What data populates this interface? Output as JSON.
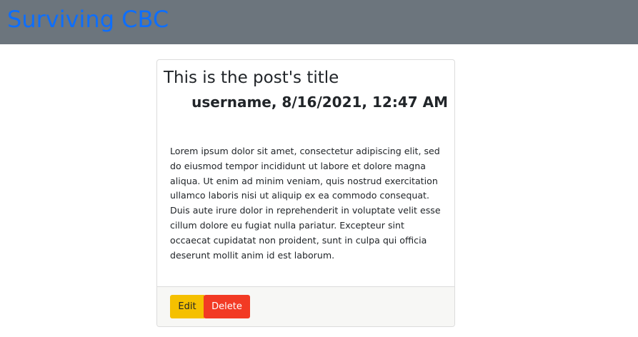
{
  "navbar": {
    "brand": "Surviving CBC"
  },
  "post": {
    "title": "This is the post's title",
    "byline": "username, 8/16/2021, 12:47 AM",
    "body": "Lorem ipsum dolor sit amet, consectetur adipiscing elit, sed do eiusmod tempor incididunt ut labore et dolore magna aliqua. Ut enim ad minim veniam, quis nostrud exercitation ullamco laboris nisi ut aliquip ex ea commodo consequat. Duis aute irure dolor in reprehenderit in voluptate velit esse cillum dolore eu fugiat nulla pariatur. Excepteur sint occaecat cupidatat non proident, sunt in culpa qui officia deserunt mollit anim id est laborum."
  },
  "actions": {
    "edit_label": "Edit",
    "delete_label": "Delete"
  },
  "colors": {
    "navbar_bg": "#6c757d",
    "brand": "#0d6efd",
    "edit_button": "#f5c000",
    "delete_button": "#f23a24",
    "footer_bg": "#f7f7f5"
  }
}
